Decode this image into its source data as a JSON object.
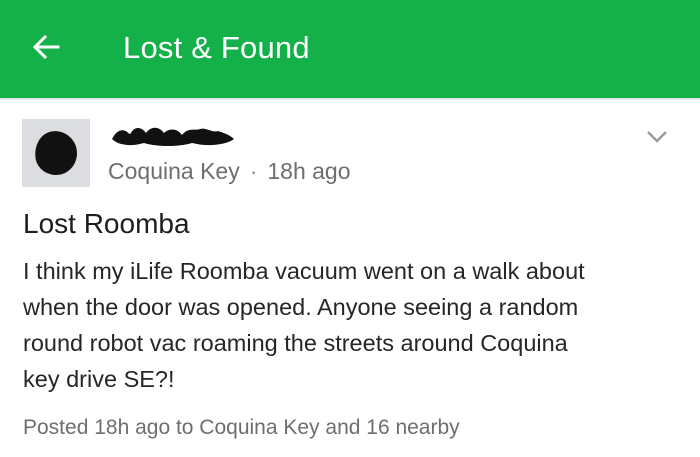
{
  "header": {
    "title": "Lost & Found",
    "back_icon": "arrow-left-icon",
    "background_color": "#14b14b"
  },
  "post": {
    "author_name_redacted": true,
    "neighborhood": "Coquina Key",
    "separator": "·",
    "time_ago": "18h ago",
    "title": "Lost Roomba",
    "body_lines": [
      "I think my iLife Roomba vacuum went on a walk about",
      "when the door was opened.  Anyone seeing a random",
      "round robot vac roaming the streets around Coquina",
      "key drive SE?!"
    ],
    "footer": "Posted 18h ago to Coquina Key and 16 nearby",
    "menu_icon": "chevron-down-icon"
  }
}
